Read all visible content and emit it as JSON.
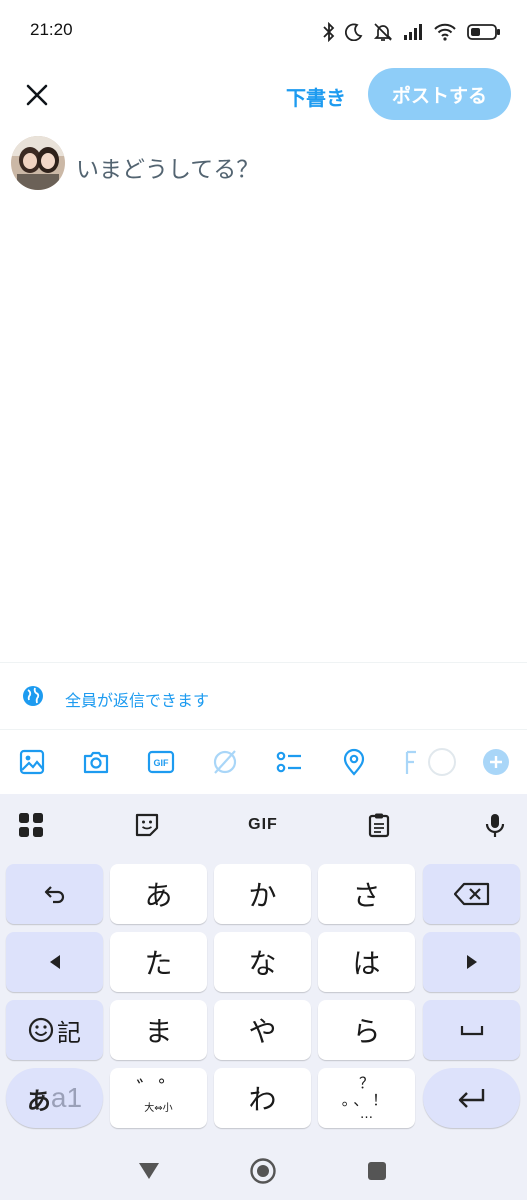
{
  "status": {
    "time": "21:20"
  },
  "header": {
    "drafts_label": "下書き",
    "post_label": "ポストする"
  },
  "compose": {
    "placeholder": "いまどうしてる？"
  },
  "reply_settings": {
    "label": "全員が返信できます"
  },
  "keyboard": {
    "toolbar": {
      "gif_label": "GIF"
    },
    "keys": {
      "a": "あ",
      "ka": "か",
      "sa": "さ",
      "ta": "た",
      "na": "な",
      "ha": "は",
      "emoji_kigo": "記",
      "ma": "ま",
      "ya": "や",
      "ra": "ら",
      "kana_mode": "あ",
      "alpha_mode": "a1",
      "dakuten_top": "゛゜",
      "dakuten_bottom": "大⇔小",
      "wa": "わ",
      "punct_top": "？",
      "punct_mid": "。、！",
      "punct_bottom": "…"
    }
  },
  "colors": {
    "accent": "#1d9bf0",
    "post_disabled": "#8ecdf8",
    "keyboard_bg": "#eef0f8",
    "fn_key": "#dde2fb"
  }
}
